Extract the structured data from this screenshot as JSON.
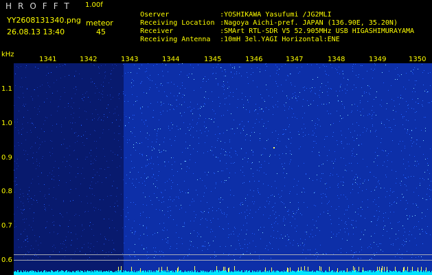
{
  "header": {
    "brand": "HROFFT",
    "version": "1.00f",
    "filename": "YY2608131340.png",
    "datetime": "26.08.13 13:40",
    "meteor_label": "meteor",
    "meteor_count": "45"
  },
  "info": [
    {
      "label": "Oserver",
      "value": ":YOSHIKAWA Yasufumi /JG2MLI"
    },
    {
      "label": "Receiving Location",
      "value": ":Nagoya Aichi-pref. JAPAN (136.90E, 35.20N)"
    },
    {
      "label": "Receiver",
      "value": ":SMArt RTL-SDR V5 52.905MHz USB HIGASHIMURAYAMA"
    },
    {
      "label": "Receiving Antenna",
      "value": ":10mH 3el.YAGI Horizontal:ENE"
    }
  ],
  "axis": {
    "y_unit": "kHz",
    "y_ticks": [
      "1.1",
      "1.0",
      "0.9",
      "0.8",
      "0.7",
      "0.6"
    ],
    "x_ticks": [
      "1341",
      "1342",
      "1343",
      "1344",
      "1345",
      "1346",
      "1347",
      "1348",
      "1349",
      "1350"
    ]
  },
  "colors": {
    "background": "#000000",
    "text_yellow": "#ffff00",
    "text_grey": "#d8d8d8",
    "spectrum_low": "#081a6e",
    "spectrum_mid": "#1f5cff",
    "spectrum_high": "#7fd9ff",
    "signal": "#ffff66",
    "baseline_band": "#00e5ff"
  }
}
